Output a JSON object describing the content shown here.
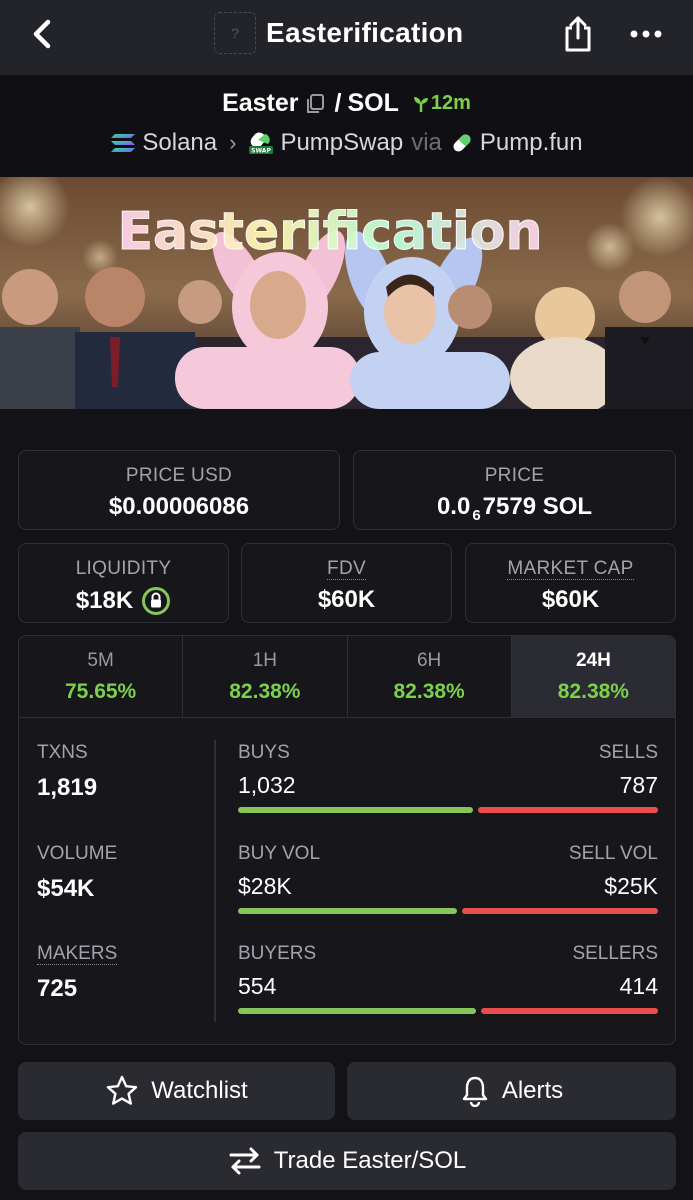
{
  "topbar": {
    "title": "Easterification",
    "token_placeholder": "?"
  },
  "pair": {
    "base": "Easter",
    "separator": "/",
    "quote": "SOL",
    "age": "12m",
    "chain": "Solana",
    "dex": "PumpSwap",
    "via_label": "via",
    "launchpad": "Pump.fun"
  },
  "banner": {
    "text": "Easterification"
  },
  "prices": {
    "price_usd_label": "PRICE USD",
    "price_usd": "$0.00006086",
    "price_label": "PRICE",
    "price_native_prefix": "0.0",
    "price_native_zeros": "6",
    "price_native_rest": "7579 SOL"
  },
  "metrics": {
    "liquidity_label": "LIQUIDITY",
    "liquidity": "$18K",
    "fdv_label": "FDV",
    "fdv": "$60K",
    "mcap_label": "MARKET CAP",
    "mcap": "$60K"
  },
  "tabs": [
    {
      "label": "5M",
      "value": "75.65%"
    },
    {
      "label": "1H",
      "value": "82.38%"
    },
    {
      "label": "6H",
      "value": "82.38%"
    },
    {
      "label": "24H",
      "value": "82.38%"
    }
  ],
  "stats": {
    "txns_label": "TXNS",
    "txns": "1,819",
    "volume_label": "VOLUME",
    "volume": "$54K",
    "makers_label": "MAKERS",
    "makers": "725",
    "buys_label": "BUYS",
    "buys": "1,032",
    "buys_num": 1032,
    "sells_label": "SELLS",
    "sells": "787",
    "sells_num": 787,
    "buy_vol_label": "BUY VOL",
    "buy_vol": "$28K",
    "buy_vol_num": 28,
    "sell_vol_label": "SELL VOL",
    "sell_vol": "$25K",
    "sell_vol_num": 25,
    "buyers_label": "BUYERS",
    "buyers": "554",
    "buyers_num": 554,
    "sellers_label": "SELLERS",
    "sellers": "414",
    "sellers_num": 414
  },
  "actions": {
    "watchlist": "Watchlist",
    "alerts": "Alerts",
    "trade": "Trade Easter/SOL"
  },
  "colors": {
    "accent_green": "#7bd14a",
    "bar_green": "#86c55a",
    "bar_red": "#ea4d4d"
  }
}
